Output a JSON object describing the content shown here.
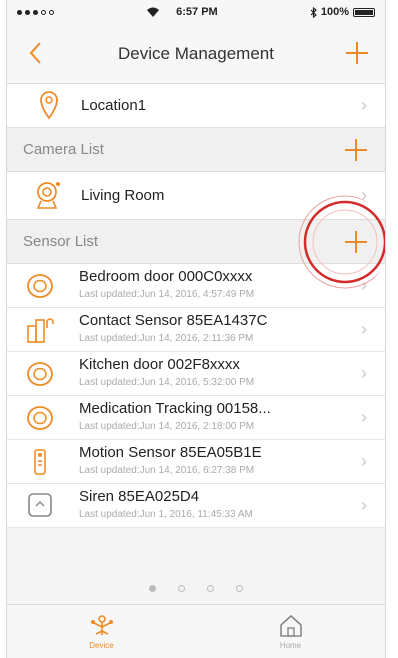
{
  "status_bar": {
    "time": "6:57 PM",
    "battery": "100%"
  },
  "nav": {
    "title": "Device Management"
  },
  "location": {
    "name": "Location1"
  },
  "camera_section": {
    "title": "Camera List"
  },
  "camera": {
    "name": "Living Room"
  },
  "sensor_section": {
    "title": "Sensor List"
  },
  "sensors": [
    {
      "name": "Bedroom door 000C0xxxx",
      "updated": "Last updated:Jun 14, 2016, 4:57:49 PM",
      "icon": "door-sensor-icon"
    },
    {
      "name": "Contact Sensor 85EA1437C",
      "updated": "Last updated:Jun 14, 2016, 2:11:36 PM",
      "icon": "contact-sensor-icon"
    },
    {
      "name": "Kitchen door 002F8xxxx",
      "updated": "Last updated:Jun 14, 2016, 5:32:00 PM",
      "icon": "door-sensor-icon"
    },
    {
      "name": "Medication Tracking 00158...",
      "updated": "Last updated:Jun 14, 2016, 2:18:00 PM",
      "icon": "door-sensor-icon"
    },
    {
      "name": "Motion Sensor 85EA05B1E",
      "updated": "Last updated:Jun 14, 2016, 6:27:38 PM",
      "icon": "motion-sensor-icon"
    },
    {
      "name": "Siren 85EA025D4",
      "updated": "Last updated:Jun 1, 2016, 11:45:33 AM",
      "icon": "siren-icon"
    }
  ],
  "pager": {
    "pages": 4,
    "active": 0
  },
  "tabs": [
    {
      "label": "Device",
      "icon": "device-icon",
      "active": true
    },
    {
      "label": "Home",
      "icon": "home-icon",
      "active": false
    }
  ],
  "colors": {
    "accent": "#f08a24",
    "highlight": "#d42a2a"
  }
}
